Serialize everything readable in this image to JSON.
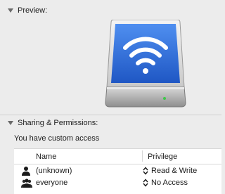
{
  "preview": {
    "title": "Preview:",
    "icon": "airport-disk-wifi-icon"
  },
  "sharing": {
    "title": "Sharing & Permissions:",
    "access_text": "You have custom access",
    "columns": {
      "name": "Name",
      "privilege": "Privilege"
    },
    "rows": [
      {
        "name": "(unknown)",
        "privilege": "Read & Write",
        "icon": "user-icon"
      },
      {
        "name": "everyone",
        "privilege": "No Access",
        "icon": "group-icon"
      }
    ]
  },
  "colors": {
    "background": "#ececec",
    "drive_screen": "#2f6fd6",
    "table_bg": "#ffffff"
  }
}
